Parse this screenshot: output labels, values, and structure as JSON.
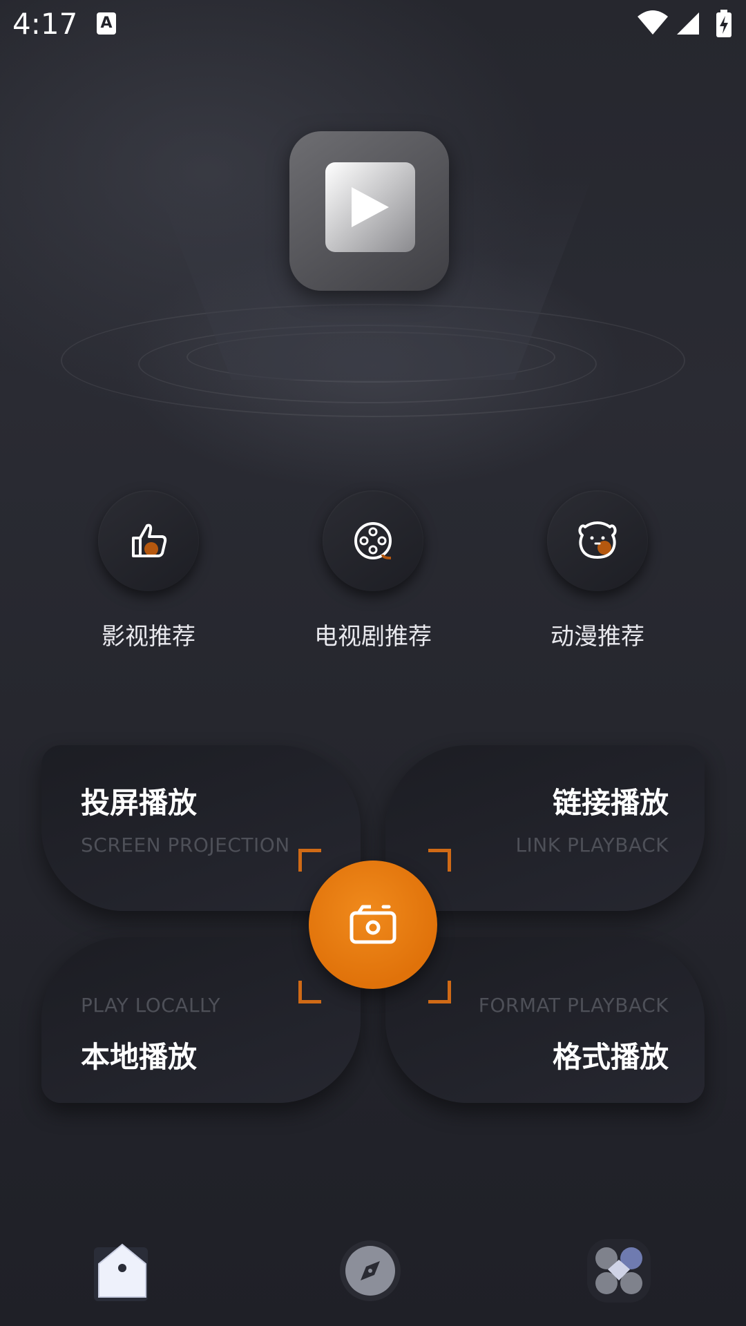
{
  "status_bar": {
    "time": "4:17",
    "notification_icon": "a-icon",
    "icons": [
      "wifi-icon",
      "cell-signal-icon",
      "battery-charging-icon"
    ]
  },
  "hero": {
    "logo_icon": "play-icon"
  },
  "categories": [
    {
      "label": "影视推荐",
      "icon": "thumbs-up-icon"
    },
    {
      "label": "电视剧推荐",
      "icon": "film-reel-icon"
    },
    {
      "label": "动漫推荐",
      "icon": "bear-face-icon"
    }
  ],
  "cards": {
    "screen_projection": {
      "title": "投屏播放",
      "subtitle": "SCREEN PROJECTION"
    },
    "link_playback": {
      "title": "链接播放",
      "subtitle": "LINK PLAYBACK"
    },
    "play_locally": {
      "title": "本地播放",
      "subtitle": "PLAY LOCALLY"
    },
    "format_playback": {
      "title": "格式播放",
      "subtitle": "FORMAT PLAYBACK"
    }
  },
  "center_button": {
    "icon": "camera-icon"
  },
  "bottom_nav": [
    {
      "icon": "home-icon",
      "active": true
    },
    {
      "icon": "compass-icon",
      "active": false
    },
    {
      "icon": "grid-apps-icon",
      "active": false
    }
  ],
  "colors": {
    "accent": "#e97d10",
    "background": "#24252c",
    "card": "#1f2027",
    "subtitle": "#4e5058"
  }
}
